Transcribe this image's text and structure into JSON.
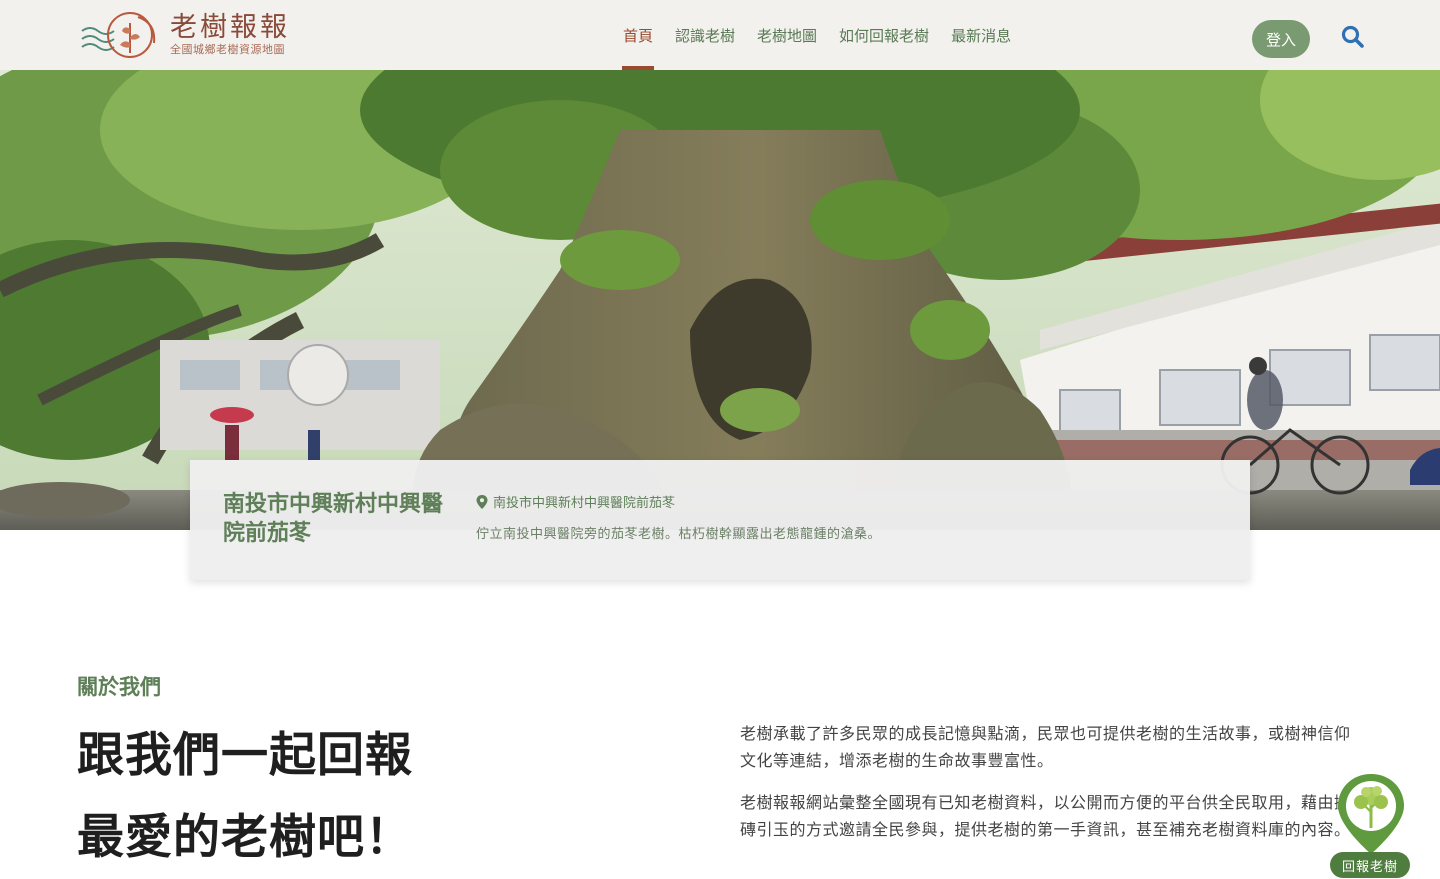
{
  "brand": {
    "title": "老樹報報",
    "subtitle": "全國城鄉老樹資源地圖"
  },
  "nav": {
    "items": [
      {
        "label": "首頁",
        "active": true
      },
      {
        "label": "認識老樹"
      },
      {
        "label": "老樹地圖"
      },
      {
        "label": "如何回報老樹"
      },
      {
        "label": "最新消息"
      }
    ],
    "login_label": "登入"
  },
  "hero": {
    "card_title": "南投市中興新村中興醫院前茄苳",
    "location": "南投市中興新村中興醫院前茄苳",
    "description": "佇立南投中興醫院旁的茄苳老樹。枯朽樹幹顯露出老態龍鍾的滄桑。"
  },
  "about": {
    "label": "關於我們",
    "heading_line1": "跟我們一起回報",
    "heading_line2": "最愛的老樹吧！",
    "paragraph1": "老樹承載了許多民眾的成長記憶與點滴，民眾也可提供老樹的生活故事，或樹神信仰文化等連結，增添老樹的生命故事豐富性。",
    "paragraph2": "老樹報報網站彙整全國現有已知老樹資料，以公開而方便的平台供全民取用，藉由拋磚引玉的方式邀請全民參與，提供老樹的第一手資訊，甚至補充老樹資料庫的內容。"
  },
  "fab": {
    "label": "回報老樹"
  },
  "colors": {
    "header_bg": "#f2f1ee",
    "nav_green": "#5a7a55",
    "nav_active": "#9a4a2e",
    "login_bg": "#7a9a72",
    "search_icon": "#2f6fb3",
    "accent_green": "#5e7f58",
    "fab_green": "#4f7c3f"
  },
  "icons": {
    "logo": "tree-logo-icon",
    "search": "search-icon",
    "pin": "map-pin-icon",
    "fab": "tree-pin-icon"
  }
}
